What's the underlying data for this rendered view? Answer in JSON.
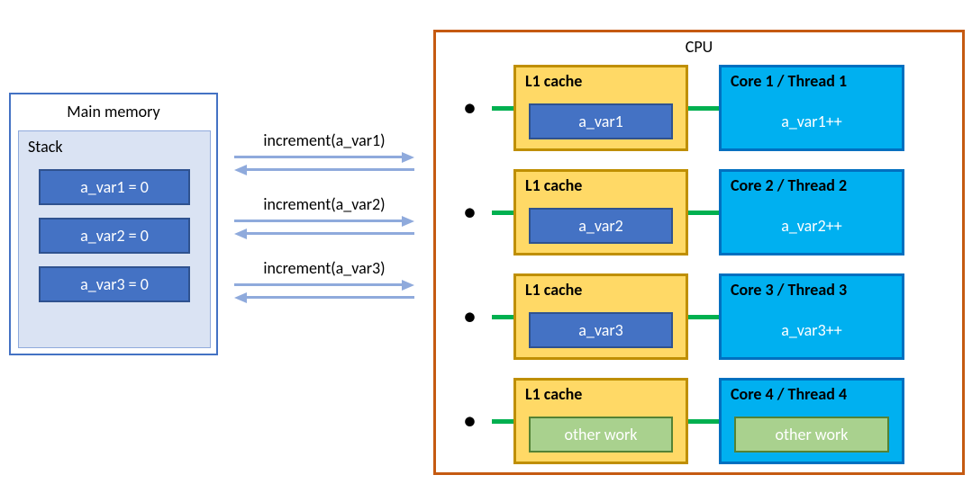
{
  "mainMemory": {
    "title": "Main memory",
    "stackLabel": "Stack",
    "vars": [
      "a_var1 = 0",
      "a_var2 = 0",
      "a_var3 = 0"
    ]
  },
  "calls": [
    "increment(a_var1)",
    "increment(a_var2)",
    "increment(a_var3)"
  ],
  "cpu": {
    "label": "CPU",
    "rows": [
      {
        "cacheTitle": "L1 cache",
        "cacheValue": "a_var1",
        "coreTitle": "Core 1 / Thread 1",
        "coreValue": "a_var1++",
        "other": false
      },
      {
        "cacheTitle": "L1 cache",
        "cacheValue": "a_var2",
        "coreTitle": "Core 2 / Thread 2",
        "coreValue": "a_var2++",
        "other": false
      },
      {
        "cacheTitle": "L1 cache",
        "cacheValue": "a_var3",
        "coreTitle": "Core 3 / Thread 3",
        "coreValue": "a_var3++",
        "other": false
      },
      {
        "cacheTitle": "L1 cache",
        "cacheValue": "other work",
        "coreTitle": "Core 4 / Thread 4",
        "coreValue": "other work",
        "other": true
      }
    ]
  }
}
